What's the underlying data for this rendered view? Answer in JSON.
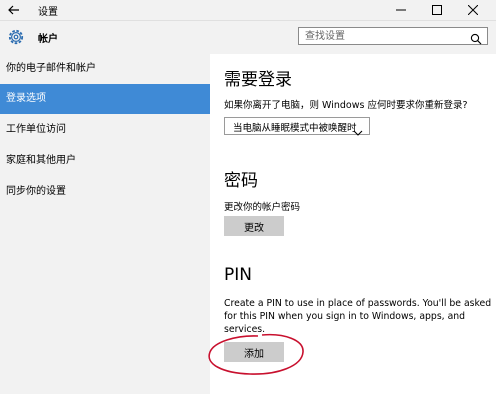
{
  "window": {
    "title": "设置",
    "back_icon": "back-arrow-icon",
    "controls": [
      "minimize-icon",
      "maximize-icon",
      "close-icon"
    ]
  },
  "header": {
    "icon": "gear-icon",
    "title": "帐户",
    "search_placeholder": "查找设置"
  },
  "sidebar": {
    "items": [
      {
        "label": "你的电子邮件和帐户",
        "active": false
      },
      {
        "label": "登录选项",
        "active": true
      },
      {
        "label": "工作单位访问",
        "active": false
      },
      {
        "label": "家庭和其他用户",
        "active": false
      },
      {
        "label": "同步你的设置",
        "active": false
      }
    ]
  },
  "sections": {
    "signin": {
      "title": "需要登录",
      "question": "如果你离开了电脑，则 Windows 应何时要求你重新登录?",
      "select_value": "当电脑从睡眠模式中被唤醒时"
    },
    "password": {
      "title": "密码",
      "text": "更改你的帐户密码",
      "button": "更改"
    },
    "pin": {
      "title": "PIN",
      "text": "Create a PIN to use in place of passwords. You'll be asked for this PIN when you sign in to Windows, apps, and services.",
      "button": "添加"
    }
  },
  "colors": {
    "accent": "#3f8ad6",
    "sidebar_bg": "#f2f2f2",
    "button_bg": "#cccccc",
    "annotation": "#c8102e"
  }
}
